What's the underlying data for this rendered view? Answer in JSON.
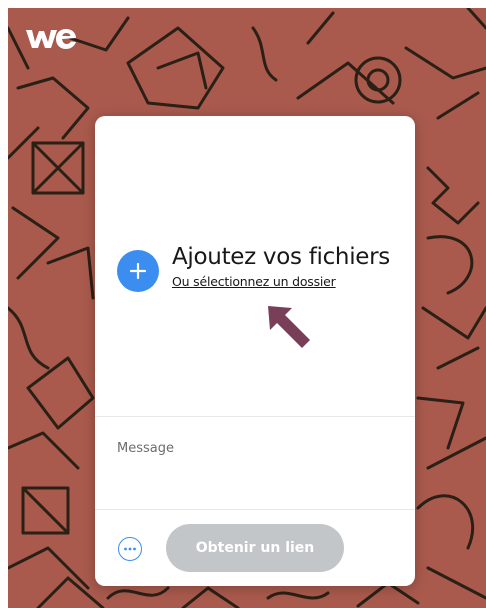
{
  "brand": {
    "logo_icon": "wetransfer-logo-icon"
  },
  "colors": {
    "background": "#a95a4d",
    "accent": "#3b8df0",
    "button_disabled": "#c3c6c9",
    "arrow": "#7a3f58"
  },
  "upload": {
    "add_icon": "plus-icon",
    "title": "Ajoutez vos fichiers",
    "folder_link": "Ou sélectionnez un dossier"
  },
  "message": {
    "placeholder": "Message",
    "value": ""
  },
  "footer": {
    "options_icon": "more-options-icon",
    "submit_label": "Obtenir un lien"
  },
  "annotation": {
    "icon": "arrow-up-left-icon"
  }
}
